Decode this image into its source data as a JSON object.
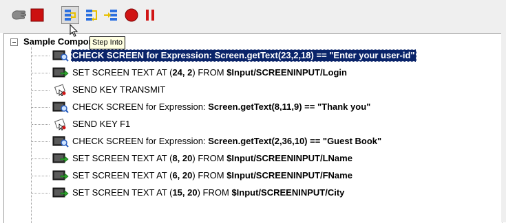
{
  "toolbar": {
    "buttons": [
      {
        "name": "hand-icon"
      },
      {
        "name": "stop-icon"
      },
      {
        "name": "step-into-icon"
      },
      {
        "name": "step-over-icon"
      },
      {
        "name": "step-out-icon"
      },
      {
        "name": "record-icon"
      },
      {
        "name": "pause-icon"
      }
    ],
    "tooltip": "Step Into"
  },
  "tree": {
    "root_label": "Sample Component",
    "rows": [
      {
        "icon": "check-screen-icon",
        "plain": "",
        "bold": "CHECK SCREEN for Expression: Screen.getText(23,2,18) == \"Enter your user-id\"",
        "selected": true
      },
      {
        "icon": "set-text-icon",
        "plain": "SET SCREEN TEXT AT (",
        "bold": "24, 2",
        "plain2": ") FROM ",
        "bold2": "$Input/SCREENINPUT/Login"
      },
      {
        "icon": "send-key-icon",
        "plain": "SEND KEY TRANSMIT"
      },
      {
        "icon": "check-screen-icon",
        "plain": "CHECK SCREEN for Expression: ",
        "bold": "Screen.getText(8,11,9) == \"Thank you\""
      },
      {
        "icon": "send-key-icon",
        "plain": "SEND KEY F1"
      },
      {
        "icon": "check-screen-icon",
        "plain": "CHECK SCREEN for Expression: ",
        "bold": "Screen.getText(2,36,10) == \"Guest Book\""
      },
      {
        "icon": "set-text-icon",
        "plain": "SET SCREEN TEXT AT (",
        "bold": "8, 20",
        "plain2": ") FROM ",
        "bold2": "$Input/SCREENINPUT/LName"
      },
      {
        "icon": "set-text-icon",
        "plain": "SET SCREEN TEXT AT (",
        "bold": "6, 20",
        "plain2": ") FROM ",
        "bold2": "$Input/SCREENINPUT/FName"
      },
      {
        "icon": "set-text-icon",
        "plain": "SET SCREEN TEXT AT (",
        "bold": "15, 20",
        "plain2": ") FROM ",
        "bold2": "$Input/SCREENINPUT/City"
      }
    ]
  }
}
